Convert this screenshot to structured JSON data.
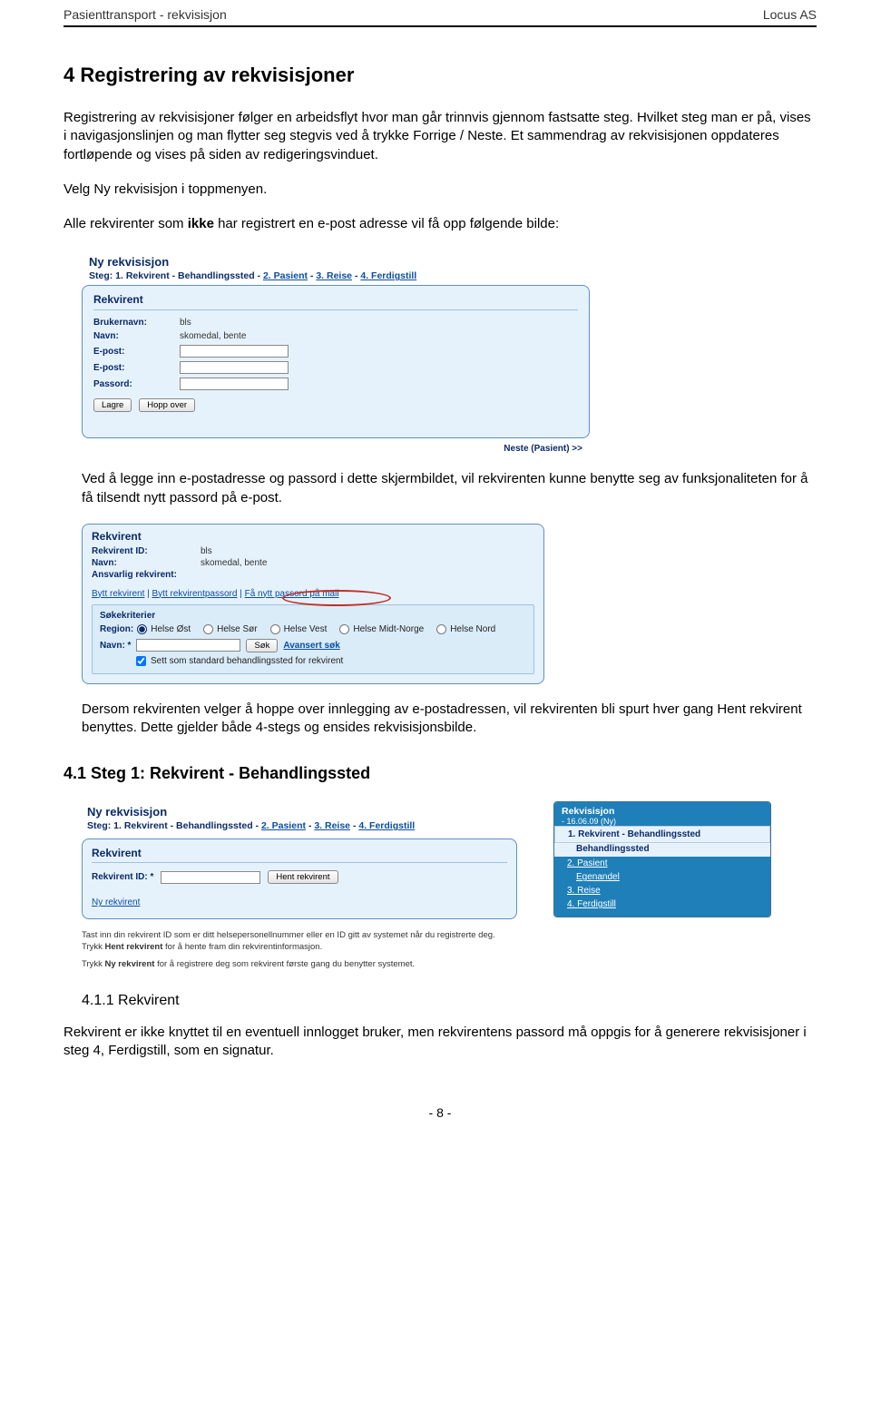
{
  "header": {
    "left": "Pasienttransport - rekvisisjon",
    "right": "Locus AS"
  },
  "h2": "4   Registrering av rekvisisjoner",
  "p1": "Registrering av rekvisisjoner følger en arbeidsflyt hvor man går trinnvis gjennom fastsatte steg. Hvilket steg man er på, vises i navigasjonslinjen og man flytter seg stegvis ved å trykke Forrige / Neste. Et sammendrag av rekvisisjonen oppdateres fortløpende og vises på siden av redigeringsvinduet.",
  "p2": "Velg Ny rekvisisjon i toppmenyen.",
  "p3_pre": "Alle rekvirenter som ",
  "p3_bold": "ikke",
  "p3_post": " har registrert en e-post adresse vil få opp følgende bilde:",
  "shot1": {
    "title": "Ny rekvisisjon",
    "steps_lead": "Steg: 1. Rekvirent - Behandlingssted - ",
    "step2": "2. Pasient",
    "step3": "3. Reise",
    "step4": "4. Ferdigstill",
    "panel_title": "Rekvirent",
    "brukernavn_lbl": "Brukernavn:",
    "brukernavn_val": "bls",
    "navn_lbl": "Navn:",
    "navn_val": "skomedal, bente",
    "epost_lbl": "E-post:",
    "epost2_lbl": "E-post:",
    "passord_lbl": "Passord:",
    "btn_lagre": "Lagre",
    "btn_hopp": "Hopp over",
    "footer": "Neste (Pasient) >>"
  },
  "p4": "Ved å legge inn e-postadresse og passord i dette skjermbildet, vil rekvirenten kunne benytte seg av funksjonaliteten for å få tilsendt nytt passord på e-post.",
  "shot2": {
    "panel_title": "Rekvirent",
    "rekvid_lbl": "Rekvirent ID:",
    "rekvid_val": "bls",
    "navn_lbl": "Navn:",
    "navn_val": "skomedal, bente",
    "ansvarlig_lbl": "Ansvarlig rekvirent:",
    "link1": "Bytt rekvirent",
    "link2": "Bytt rekvirentpassord",
    "link3": "Få nytt passord på mail",
    "sub_title": "Søkekriterier",
    "region_lbl": "Region:",
    "radios": [
      "Helse Øst",
      "Helse Sør",
      "Helse Vest",
      "Helse Midt-Norge",
      "Helse Nord"
    ],
    "navn2_lbl": "Navn: *",
    "sok_btn": "Søk",
    "adv": "Avansert søk",
    "check_lbl": "Sett som standard behandlingssted for rekvirent"
  },
  "p5": "Dersom rekvirenten velger å hoppe over innlegging av e-postadressen, vil rekvirenten bli spurt hver gang Hent rekvirent benyttes. Dette gjelder både 4-stegs og ensides rekvisisjonsbilde.",
  "h3": "4.1      Steg 1: Rekvirent - Behandlingssted",
  "shot3": {
    "title": "Ny rekvisisjon",
    "steps_lead": "Steg: 1. Rekvirent - Behandlingssted - ",
    "step2": "2. Pasient",
    "step3": "3. Reise",
    "step4": "4. Ferdigstill",
    "panel_title": "Rekvirent",
    "rekvid_lbl": "Rekvirent ID: *",
    "btn_hent": "Hent rekvirent",
    "nyrekv_link": "Ny rekvirent",
    "help1_pre": "Tast inn din rekvirent ID som er ditt helsepersonellnummer eller en ID gitt av systemet når du registrerte deg. Trykk ",
    "help1_b": "Hent rekvirent",
    "help1_post": " for å hente fram din rekvirentinformasjon.",
    "help2_pre": "Trykk ",
    "help2_b": "Ny rekvirent",
    "help2_post": " for å registrere deg som rekvirent første gang du benytter systemet.",
    "right_title": "Rekvisisjon",
    "right_date": "- 16.06.09 (Ny)",
    "right_items": [
      "1. Rekvirent - Behandlingssted",
      "Behandlingssted",
      "2. Pasient",
      "Egenandel",
      "3. Reise",
      "4. Ferdigstill"
    ]
  },
  "h4": "4.1.1   Rekvirent",
  "p6": "Rekvirent er ikke knyttet til en eventuell innlogget bruker, men rekvirentens passord må oppgis for å generere rekvisisjoner i steg 4, Ferdigstill, som en signatur.",
  "pagenum": "- 8 -"
}
